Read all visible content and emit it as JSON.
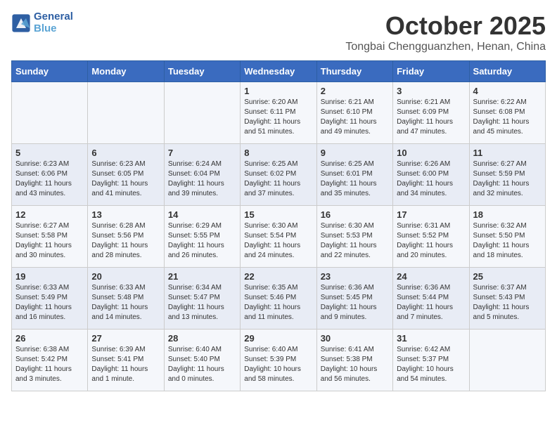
{
  "header": {
    "logo_line1": "General",
    "logo_line2": "Blue",
    "month": "October 2025",
    "location": "Tongbai Chengguanzhen, Henan, China"
  },
  "days_of_week": [
    "Sunday",
    "Monday",
    "Tuesday",
    "Wednesday",
    "Thursday",
    "Friday",
    "Saturday"
  ],
  "weeks": [
    [
      {
        "day": "",
        "text": ""
      },
      {
        "day": "",
        "text": ""
      },
      {
        "day": "",
        "text": ""
      },
      {
        "day": "1",
        "text": "Sunrise: 6:20 AM\nSunset: 6:11 PM\nDaylight: 11 hours and 51 minutes."
      },
      {
        "day": "2",
        "text": "Sunrise: 6:21 AM\nSunset: 6:10 PM\nDaylight: 11 hours and 49 minutes."
      },
      {
        "day": "3",
        "text": "Sunrise: 6:21 AM\nSunset: 6:09 PM\nDaylight: 11 hours and 47 minutes."
      },
      {
        "day": "4",
        "text": "Sunrise: 6:22 AM\nSunset: 6:08 PM\nDaylight: 11 hours and 45 minutes."
      }
    ],
    [
      {
        "day": "5",
        "text": "Sunrise: 6:23 AM\nSunset: 6:06 PM\nDaylight: 11 hours and 43 minutes."
      },
      {
        "day": "6",
        "text": "Sunrise: 6:23 AM\nSunset: 6:05 PM\nDaylight: 11 hours and 41 minutes."
      },
      {
        "day": "7",
        "text": "Sunrise: 6:24 AM\nSunset: 6:04 PM\nDaylight: 11 hours and 39 minutes."
      },
      {
        "day": "8",
        "text": "Sunrise: 6:25 AM\nSunset: 6:02 PM\nDaylight: 11 hours and 37 minutes."
      },
      {
        "day": "9",
        "text": "Sunrise: 6:25 AM\nSunset: 6:01 PM\nDaylight: 11 hours and 35 minutes."
      },
      {
        "day": "10",
        "text": "Sunrise: 6:26 AM\nSunset: 6:00 PM\nDaylight: 11 hours and 34 minutes."
      },
      {
        "day": "11",
        "text": "Sunrise: 6:27 AM\nSunset: 5:59 PM\nDaylight: 11 hours and 32 minutes."
      }
    ],
    [
      {
        "day": "12",
        "text": "Sunrise: 6:27 AM\nSunset: 5:58 PM\nDaylight: 11 hours and 30 minutes."
      },
      {
        "day": "13",
        "text": "Sunrise: 6:28 AM\nSunset: 5:56 PM\nDaylight: 11 hours and 28 minutes."
      },
      {
        "day": "14",
        "text": "Sunrise: 6:29 AM\nSunset: 5:55 PM\nDaylight: 11 hours and 26 minutes."
      },
      {
        "day": "15",
        "text": "Sunrise: 6:30 AM\nSunset: 5:54 PM\nDaylight: 11 hours and 24 minutes."
      },
      {
        "day": "16",
        "text": "Sunrise: 6:30 AM\nSunset: 5:53 PM\nDaylight: 11 hours and 22 minutes."
      },
      {
        "day": "17",
        "text": "Sunrise: 6:31 AM\nSunset: 5:52 PM\nDaylight: 11 hours and 20 minutes."
      },
      {
        "day": "18",
        "text": "Sunrise: 6:32 AM\nSunset: 5:50 PM\nDaylight: 11 hours and 18 minutes."
      }
    ],
    [
      {
        "day": "19",
        "text": "Sunrise: 6:33 AM\nSunset: 5:49 PM\nDaylight: 11 hours and 16 minutes."
      },
      {
        "day": "20",
        "text": "Sunrise: 6:33 AM\nSunset: 5:48 PM\nDaylight: 11 hours and 14 minutes."
      },
      {
        "day": "21",
        "text": "Sunrise: 6:34 AM\nSunset: 5:47 PM\nDaylight: 11 hours and 13 minutes."
      },
      {
        "day": "22",
        "text": "Sunrise: 6:35 AM\nSunset: 5:46 PM\nDaylight: 11 hours and 11 minutes."
      },
      {
        "day": "23",
        "text": "Sunrise: 6:36 AM\nSunset: 5:45 PM\nDaylight: 11 hours and 9 minutes."
      },
      {
        "day": "24",
        "text": "Sunrise: 6:36 AM\nSunset: 5:44 PM\nDaylight: 11 hours and 7 minutes."
      },
      {
        "day": "25",
        "text": "Sunrise: 6:37 AM\nSunset: 5:43 PM\nDaylight: 11 hours and 5 minutes."
      }
    ],
    [
      {
        "day": "26",
        "text": "Sunrise: 6:38 AM\nSunset: 5:42 PM\nDaylight: 11 hours and 3 minutes."
      },
      {
        "day": "27",
        "text": "Sunrise: 6:39 AM\nSunset: 5:41 PM\nDaylight: 11 hours and 1 minute."
      },
      {
        "day": "28",
        "text": "Sunrise: 6:40 AM\nSunset: 5:40 PM\nDaylight: 11 hours and 0 minutes."
      },
      {
        "day": "29",
        "text": "Sunrise: 6:40 AM\nSunset: 5:39 PM\nDaylight: 10 hours and 58 minutes."
      },
      {
        "day": "30",
        "text": "Sunrise: 6:41 AM\nSunset: 5:38 PM\nDaylight: 10 hours and 56 minutes."
      },
      {
        "day": "31",
        "text": "Sunrise: 6:42 AM\nSunset: 5:37 PM\nDaylight: 10 hours and 54 minutes."
      },
      {
        "day": "",
        "text": ""
      }
    ]
  ]
}
